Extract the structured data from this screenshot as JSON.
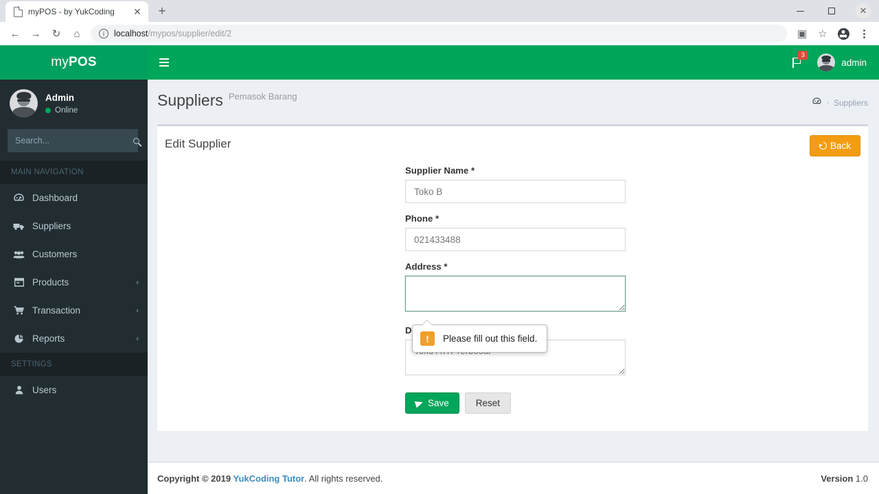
{
  "browser": {
    "tab": {
      "title": "myPOS - by YukCoding",
      "favicon_icon": "page-icon",
      "close_icon": "close-icon"
    },
    "new_tab_icon": "plus-icon",
    "window_controls": {
      "minimize_icon": "minimize-icon",
      "maximize_icon": "maximize-icon",
      "close_icon": "close-icon"
    },
    "nav": {
      "back_icon": "arrow-left-icon",
      "forward_icon": "arrow-right-icon",
      "reload_icon": "reload-icon",
      "home_icon": "home-icon"
    },
    "omnibox": {
      "info_icon": "info-circle-icon",
      "url_host": "localhost",
      "url_path": "/mypos/supplier/edit/2"
    },
    "toolbar_right": {
      "translate_icon": "translate-icon",
      "bookmark_icon": "star-icon",
      "profile_icon": "profile-avatar-icon",
      "menu_icon": "kebab-menu-icon"
    }
  },
  "app": {
    "brand": {
      "prefix": "my",
      "suffix": "POS"
    },
    "navbar": {
      "toggle_icon": "hamburger-icon",
      "flag_icon": "flag-icon",
      "flag_badge": "3",
      "user_avatar_icon": "user-avatar",
      "user_label": "admin"
    },
    "sidebar": {
      "user": {
        "avatar_icon": "user-avatar",
        "name": "Admin",
        "status": "Online",
        "status_dot_icon": "online-dot-icon"
      },
      "search": {
        "placeholder": "Search...",
        "value": "",
        "button_icon": "search-icon"
      },
      "sections": [
        {
          "header": "MAIN NAVIGATION",
          "items": [
            {
              "label": "Dashboard",
              "icon": "dashboard-icon",
              "glyph": "⚙",
              "chevron": ""
            },
            {
              "label": "Suppliers",
              "icon": "truck-icon",
              "glyph": "⚑",
              "chevron": ""
            },
            {
              "label": "Customers",
              "icon": "users-icon",
              "glyph": "♟",
              "chevron": ""
            },
            {
              "label": "Products",
              "icon": "box-icon",
              "glyph": "▤",
              "chevron": "‹"
            },
            {
              "label": "Transaction",
              "icon": "cart-icon",
              "glyph": "⛟",
              "chevron": "‹"
            },
            {
              "label": "Reports",
              "icon": "pie-chart-icon",
              "glyph": "◔",
              "chevron": "‹"
            }
          ]
        },
        {
          "header": "SETTINGS",
          "items": [
            {
              "label": "Users",
              "icon": "user-icon",
              "glyph": "♟",
              "chevron": ""
            }
          ]
        }
      ]
    },
    "page": {
      "title": "Suppliers",
      "subtitle": "Pemasok Barang",
      "breadcrumb": {
        "home_icon": "home-dashboard-icon",
        "separator": "›",
        "current": "Suppliers"
      }
    },
    "card": {
      "title": "Edit Supplier",
      "back_button": {
        "label": "Back",
        "icon": "undo-icon"
      },
      "form": {
        "fields": [
          {
            "label": "Supplier Name *",
            "name": "supplier-name",
            "value": "Toko B",
            "placeholder": "",
            "type": "text"
          },
          {
            "label": "Phone *",
            "name": "phone",
            "value": "021433488",
            "placeholder": "",
            "type": "text"
          },
          {
            "label": "Address *",
            "name": "address",
            "value": "",
            "placeholder": "",
            "type": "textarea"
          },
          {
            "label": "Description",
            "name": "description",
            "value": "Toko ATK Terbesar",
            "placeholder": "",
            "type": "textarea"
          }
        ],
        "save_button": {
          "label": "Save",
          "icon": "send-icon"
        },
        "reset_button": {
          "label": "Reset"
        }
      },
      "validation_bubble": {
        "text": "Please fill out this field.",
        "icon": "warning-icon",
        "glyph": "!"
      }
    },
    "footer": {
      "copyright_prefix": "Copyright © 2019 ",
      "link": "YukCoding Tutor",
      "copyright_suffix": ". All rights reserved.",
      "version_label": "Version",
      "version_value": "1.0"
    }
  },
  "colors": {
    "brand_green": "#00a160",
    "navbar_green": "#00a65a",
    "sidebar_dark": "#222d32",
    "content_bg": "#ecf0f5",
    "back_orange": "#f39c12",
    "badge_red": "#dd4b39",
    "link_blue": "#3c8dbc",
    "warning_orange": "#f0a02a"
  }
}
